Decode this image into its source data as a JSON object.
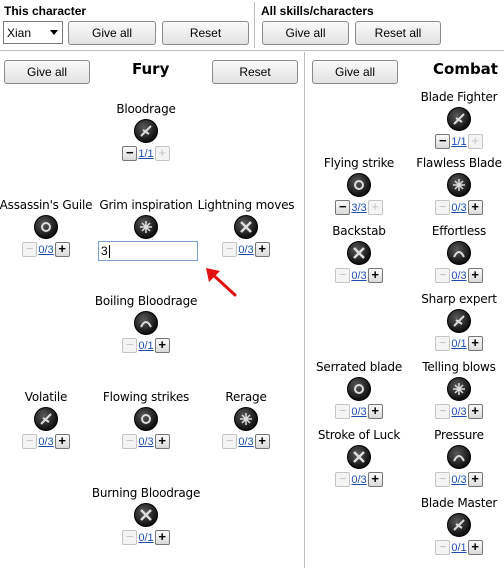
{
  "header": {
    "this_character": "This character",
    "all_skills": "All skills/characters",
    "character_select": "Xian",
    "give_all": "Give all",
    "reset": "Reset",
    "reset_all": "Reset all"
  },
  "fury": {
    "title": "Fury",
    "give_all": "Give all",
    "reset": "Reset",
    "input_value": "3",
    "skills": [
      {
        "name": "Bloodrage",
        "value": "1/1",
        "minus_enabled": true,
        "plus_enabled": false,
        "icon": "bloodrage-icon"
      },
      {
        "name": "Assassin's Guile",
        "value": "0/3",
        "minus_enabled": false,
        "plus_enabled": true,
        "icon": "guile-icon"
      },
      {
        "name": "Grim inspiration",
        "value": "",
        "minus_enabled": false,
        "plus_enabled": false,
        "icon": "grim-inspiration-icon"
      },
      {
        "name": "Lightning moves",
        "value": "0/3",
        "minus_enabled": false,
        "plus_enabled": true,
        "icon": "lightning-moves-icon"
      },
      {
        "name": "Boiling Bloodrage",
        "value": "0/1",
        "minus_enabled": false,
        "plus_enabled": true,
        "icon": "boiling-bloodrage-icon"
      },
      {
        "name": "Volatile",
        "value": "0/3",
        "minus_enabled": false,
        "plus_enabled": true,
        "icon": "volatile-icon"
      },
      {
        "name": "Flowing strikes",
        "value": "0/3",
        "minus_enabled": false,
        "plus_enabled": true,
        "icon": "flowing-strikes-icon"
      },
      {
        "name": "Rerage",
        "value": "0/3",
        "minus_enabled": false,
        "plus_enabled": true,
        "icon": "rerage-icon"
      },
      {
        "name": "Burning Bloodrage",
        "value": "0/1",
        "minus_enabled": false,
        "plus_enabled": true,
        "icon": "burning-bloodrage-icon"
      }
    ]
  },
  "combat": {
    "title": "Combat",
    "give_all": "Give all",
    "skills": [
      {
        "name": "Blade Fighter",
        "value": "1/1",
        "minus_enabled": true,
        "plus_enabled": false,
        "icon": "blade-fighter-icon"
      },
      {
        "name": "Flying strike",
        "value": "3/3",
        "minus_enabled": true,
        "plus_enabled": false,
        "icon": "flying-strike-icon"
      },
      {
        "name": "Flawless Blade",
        "value": "0/3",
        "minus_enabled": false,
        "plus_enabled": true,
        "icon": "flawless-blade-icon"
      },
      {
        "name": "Backstab",
        "value": "0/3",
        "minus_enabled": false,
        "plus_enabled": true,
        "icon": "backstab-icon"
      },
      {
        "name": "Effortless",
        "value": "0/3",
        "minus_enabled": false,
        "plus_enabled": true,
        "icon": "effortless-icon"
      },
      {
        "name": "Sharp expert",
        "value": "0/1",
        "minus_enabled": false,
        "plus_enabled": true,
        "icon": "sharp-expert-icon"
      },
      {
        "name": "Serrated blade",
        "value": "0/3",
        "minus_enabled": false,
        "plus_enabled": true,
        "icon": "serrated-blade-icon"
      },
      {
        "name": "Telling blows",
        "value": "0/3",
        "minus_enabled": false,
        "plus_enabled": true,
        "icon": "telling-blows-icon"
      },
      {
        "name": "Stroke of Luck",
        "value": "0/3",
        "minus_enabled": false,
        "plus_enabled": true,
        "icon": "stroke-of-luck-icon"
      },
      {
        "name": "Pressure",
        "value": "0/3",
        "minus_enabled": false,
        "plus_enabled": true,
        "icon": "pressure-icon"
      },
      {
        "name": "Blade Master",
        "value": "0/1",
        "minus_enabled": false,
        "plus_enabled": true,
        "icon": "blade-master-icon"
      }
    ]
  },
  "annotation": {
    "arrow_color": "#e01010"
  },
  "colors": {
    "link_value": "#1e4fb0",
    "separator": "#bdbdbd"
  }
}
